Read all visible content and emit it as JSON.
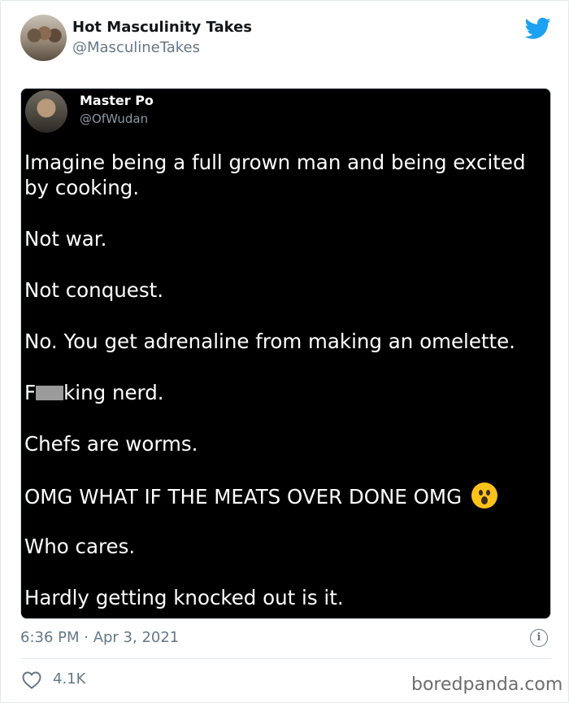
{
  "tweet": {
    "display_name": "Hot Masculinity Takes",
    "handle": "@MasculineTakes",
    "timestamp": "6:36 PM · Apr 3, 2021",
    "likes": "4.1K",
    "icons": [
      "twitter-bird-icon",
      "info-icon",
      "heart-icon"
    ],
    "accent_color": "#1da1f2"
  },
  "screenshot": {
    "display_name": "Master Po",
    "handle": "@OfWudan",
    "lines": [
      "Imagine being a full grown man and being excited by cooking.",
      "Not war.",
      "Not conquest.",
      "No. You get adrenaline from making an omelette.",
      "F",
      "king nerd.",
      "Chefs are worms.",
      "OMG WHAT IF THE MEATS OVER DONE OMG",
      "Who cares.",
      "Hardly getting knocked out is it."
    ]
  },
  "watermark": "boredpanda.com"
}
